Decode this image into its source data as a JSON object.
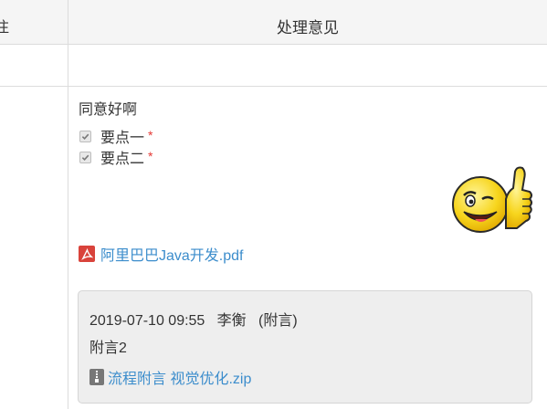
{
  "table": {
    "left_header_partial": "注",
    "header_title": "处理意见"
  },
  "opinion": {
    "text": "同意好啊",
    "points": [
      {
        "label": "要点一",
        "required_mark": "*",
        "checked": true
      },
      {
        "label": "要点二",
        "required_mark": "*",
        "checked": true
      }
    ],
    "sticker_icon": "thumbs-up-wink-emoji-icon",
    "attachment": {
      "icon": "pdf-file-icon",
      "name": "阿里巴巴Java开发.pdf"
    }
  },
  "note": {
    "timestamp": "2019-07-10 09:55",
    "author": "李衡",
    "type": "(附言)",
    "text": "附言2",
    "attachment": {
      "icon": "zip-file-icon",
      "name": "流程附言 视觉优化.zip"
    }
  },
  "colors": {
    "link": "#3c8dcc",
    "required": "#e53935",
    "pdf_icon": "#d9433b",
    "note_bg": "#eeeeee"
  }
}
